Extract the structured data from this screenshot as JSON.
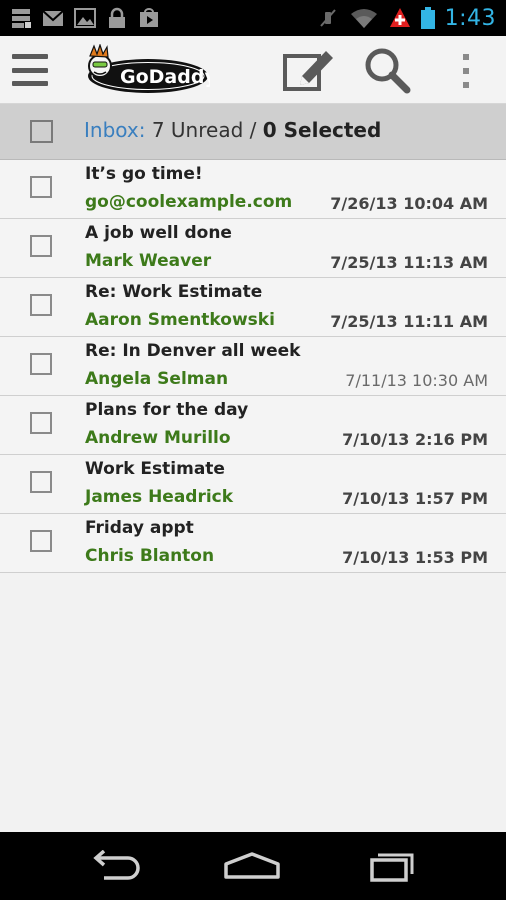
{
  "status_bar": {
    "time": "1:43",
    "icons": [
      "server-icon",
      "gmail-icon",
      "image-icon",
      "lock-icon",
      "play-store-icon",
      "mute-icon",
      "wifi-icon",
      "swiss-flag-icon",
      "battery-icon"
    ],
    "accent": "#33b5e5"
  },
  "action_bar": {
    "logo_text": "GoDaddy",
    "icons": [
      "menu-icon",
      "compose-icon",
      "search-icon",
      "overflow-icon"
    ]
  },
  "inbox": {
    "label": "Inbox:",
    "unread_count": "7",
    "unread_label": "Unread /",
    "selected_count": "0",
    "selected_label": "Selected"
  },
  "emails": [
    {
      "subject": "It’s go time!",
      "sender": "go@coolexample.com",
      "date": "7/26/13 10:04 AM",
      "bold_date": true
    },
    {
      "subject": "A job well done",
      "sender": "Mark Weaver",
      "date": "7/25/13 11:13 AM",
      "bold_date": true
    },
    {
      "subject": "Re: Work Estimate",
      "sender": "Aaron Smentkowski",
      "date": "7/25/13 11:11 AM",
      "bold_date": true
    },
    {
      "subject": "Re: In Denver all week",
      "sender": "Angela Selman",
      "date": "7/11/13 10:30 AM",
      "bold_date": false
    },
    {
      "subject": "Plans for the day",
      "sender": "Andrew Murillo",
      "date": "7/10/13 2:16 PM",
      "bold_date": true
    },
    {
      "subject": "Work Estimate",
      "sender": "James Headrick",
      "date": "7/10/13 1:57 PM",
      "bold_date": true
    },
    {
      "subject": "Friday appt",
      "sender": "Chris Blanton",
      "date": "7/10/13 1:53 PM",
      "bold_date": true
    }
  ],
  "colors": {
    "sender_green": "#3d7a1a",
    "inbox_blue": "#3a7fbf",
    "header_gray": "#cfcfcf"
  },
  "nav_bar": {
    "icons": [
      "back-icon",
      "home-icon",
      "recent-apps-icon"
    ]
  }
}
